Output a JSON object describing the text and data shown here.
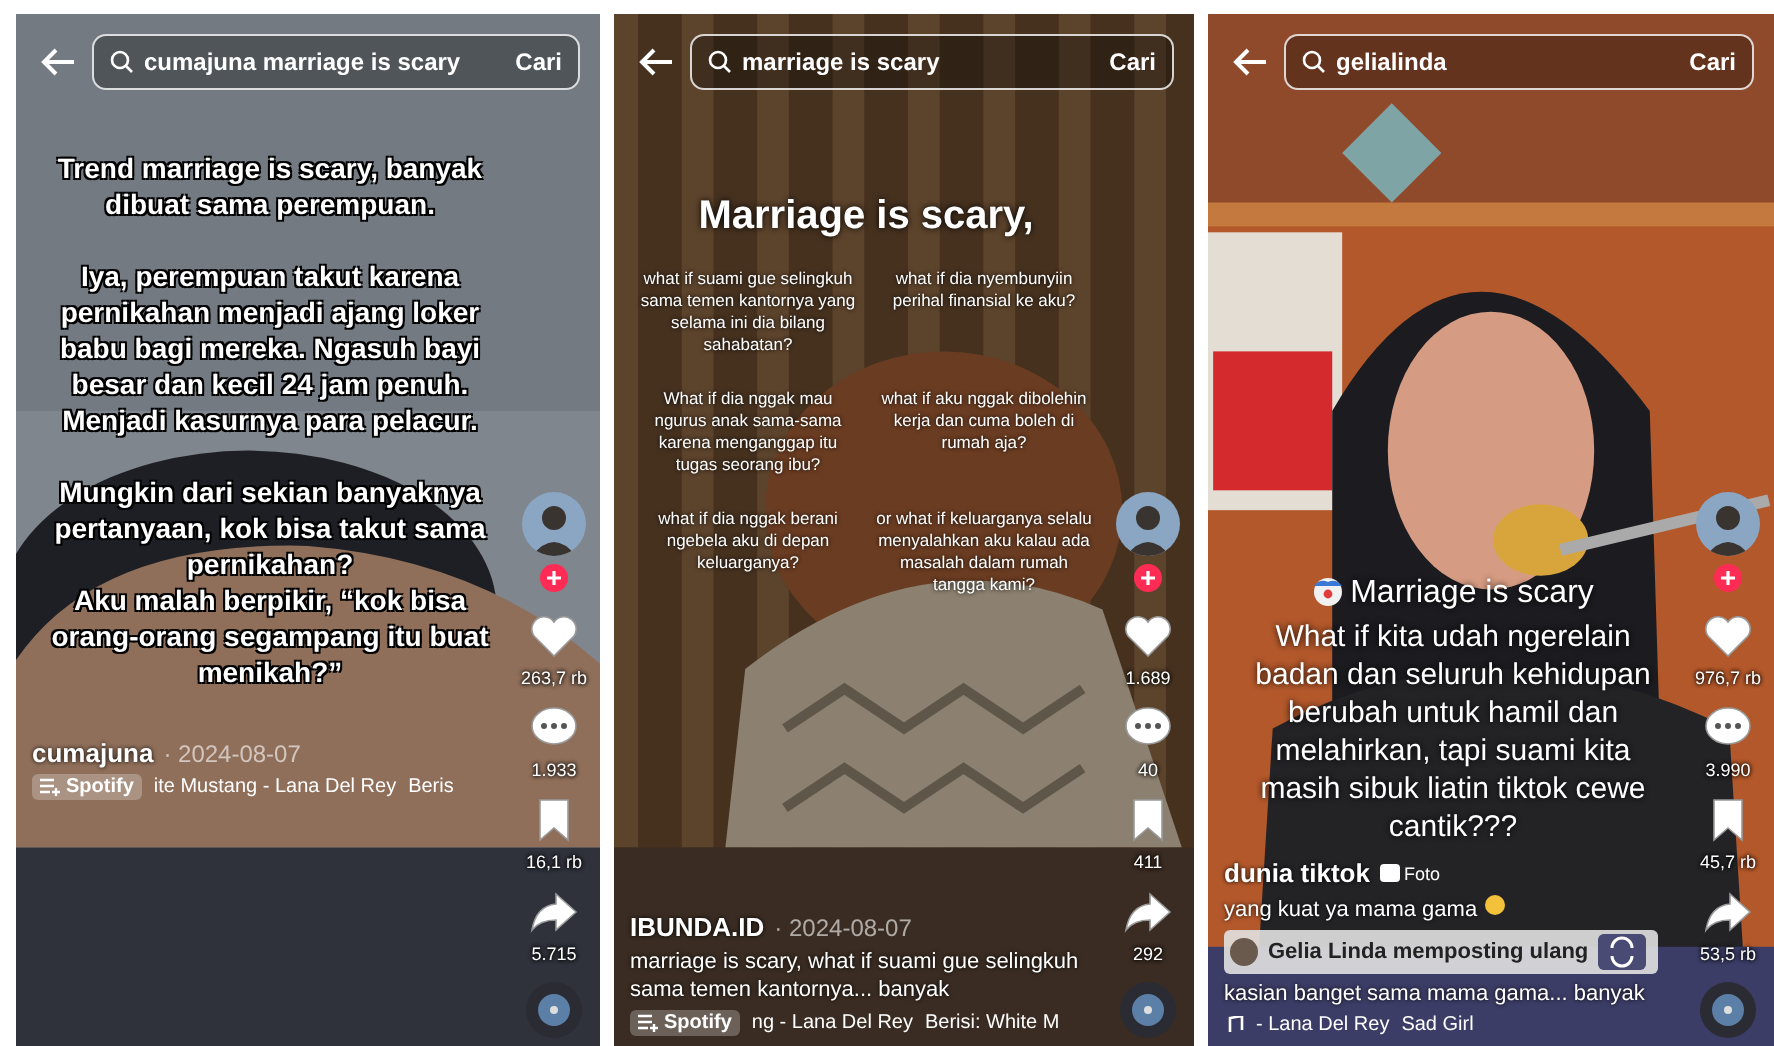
{
  "panels": [
    {
      "search": {
        "query": "cumajuna marriage is scary",
        "button": "Cari"
      },
      "overlay": {
        "kind": "outlined",
        "items": [
          "Trend marriage is scary, banyak dibuat sama perempuan.",
          "Iya, perempuan takut karena pernikahan menjadi ajang loker babu bagi mereka. Ngasuh bayi besar dan kecil 24 jam penuh. Menjadi kasurnya para pelacur.",
          "Mungkin dari sekian banyaknya pertanyaan, kok bisa takut sama pernikahan?",
          "Aku malah berpikir, “kok bisa orang-orang segampang itu buat menikah?”"
        ]
      },
      "actions": [
        {
          "kind": "like",
          "count": "263,7 rb"
        },
        {
          "kind": "comment",
          "count": "1.933"
        },
        {
          "kind": "save",
          "count": "16,1 rb"
        },
        {
          "kind": "share",
          "count": "5.715"
        }
      ],
      "author": "cumajuna",
      "date": "· 2024-08-07",
      "music": {
        "label": "Spotify",
        "track": "ite Mustang - Lana Del Rey",
        "extra": "Beris"
      }
    },
    {
      "search": {
        "query": "marriage is scary",
        "button": "Cari"
      },
      "overlay": {
        "kind": "grid",
        "title": "Marriage is scary,",
        "items": [
          "what if suami gue selingkuh sama temen kantornya yang selama ini dia bilang sahabatan?",
          "what if dia nyembunyiin perihal finansial ke aku?",
          "What if dia nggak mau ngurus anak sama-sama karena menganggap itu tugas seorang ibu?",
          "what if aku nggak dibolehin kerja dan cuma boleh di rumah aja?",
          "what if dia nggak berani ngebela aku di depan keluarganya?",
          "or what if keluarganya selalu menyalahkan aku kalau ada masalah dalam rumah tangga kami?"
        ]
      },
      "actions": [
        {
          "kind": "like",
          "count": "1.689"
        },
        {
          "kind": "comment",
          "count": "40"
        },
        {
          "kind": "save",
          "count": "411"
        },
        {
          "kind": "share",
          "count": "292"
        }
      ],
      "author": "IBUNDA.ID",
      "date": "· 2024-08-07",
      "captions": [
        "marriage is scary, what if suami gue selingkuh sama temen kantornya... banyak"
      ],
      "music": {
        "label": "Spotify",
        "track": "ng - Lana Del Rey",
        "extra": "Berisi: White M"
      }
    },
    {
      "search": {
        "query": "gelialinda",
        "button": "Cari"
      },
      "overlay": {
        "kind": "plain",
        "title": "Marriage is scary",
        "items": [
          "What if kita udah ngerelain badan dan seluruh kehidupan berubah untuk hamil dan melahirkan, tapi suami kita masih sibuk liatin tiktok cewe cantik???"
        ]
      },
      "actions": [
        {
          "kind": "like",
          "count": "976,7 rb"
        },
        {
          "kind": "comment",
          "count": "3.990"
        },
        {
          "kind": "save",
          "count": "45,7 rb"
        },
        {
          "kind": "share",
          "count": "53,5 rb"
        }
      ],
      "author": "dunia tiktok",
      "badge": "Foto",
      "repost": "Gelia Linda memposting ulang",
      "captions": [
        "yang kuat ya mama gama",
        "kasian banget sama mama gama... banyak"
      ],
      "music": {
        "track": "- Lana Del Rey",
        "extra": "Sad Girl"
      }
    }
  ]
}
